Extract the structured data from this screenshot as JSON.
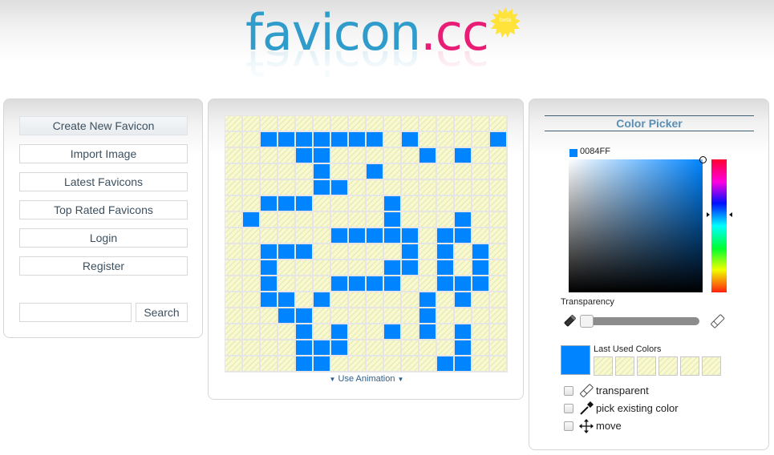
{
  "header": {
    "logo_main": "favicon",
    "logo_tld": ".cc",
    "badge": "beta"
  },
  "nav": {
    "items": [
      {
        "label": "Create New Favicon"
      },
      {
        "label": "Import Image"
      },
      {
        "label": "Latest Favicons"
      },
      {
        "label": "Top Rated Favicons"
      },
      {
        "label": "Login"
      },
      {
        "label": "Register"
      }
    ],
    "search": {
      "value": "",
      "placeholder": "",
      "button_label": "Search"
    }
  },
  "editor": {
    "grid_size": 16,
    "pixel_color": "#0084FF",
    "empty_pattern": "transparent",
    "filled_pixels": [
      [],
      [
        2,
        3,
        4,
        5,
        6,
        7,
        8,
        10,
        15
      ],
      [
        4,
        5,
        11,
        13
      ],
      [
        5,
        8
      ],
      [
        5,
        6
      ],
      [
        2,
        3,
        4,
        9
      ],
      [
        1,
        9,
        13
      ],
      [
        6,
        7,
        8,
        9,
        10,
        12,
        13
      ],
      [
        2,
        3,
        4,
        10,
        12,
        14
      ],
      [
        2,
        9,
        10,
        12,
        14
      ],
      [
        2,
        6,
        7,
        8,
        9,
        12,
        13,
        14
      ],
      [
        2,
        3,
        5,
        11,
        13
      ],
      [
        3,
        4,
        11
      ],
      [
        4,
        6,
        9,
        11,
        13
      ],
      [
        4,
        5,
        6,
        13
      ],
      [
        4,
        5,
        12,
        13
      ]
    ],
    "animation_toggle": "Use Animation"
  },
  "color_picker": {
    "title": "Color Picker",
    "current_hex": "0084FF",
    "current_color": "#0084FF",
    "transparency_label": "Transparency",
    "transparency_percent": 0,
    "last_used_label": "Last Used Colors",
    "last_used": [
      "transparent",
      "transparent",
      "transparent",
      "transparent",
      "transparent",
      "transparent"
    ],
    "options": [
      {
        "label": "transparent",
        "icon": "eraser-icon",
        "checked": false
      },
      {
        "label": "pick existing color",
        "icon": "eyedropper-icon",
        "checked": false
      },
      {
        "label": "move",
        "icon": "move-arrows-icon",
        "checked": false
      }
    ]
  }
}
